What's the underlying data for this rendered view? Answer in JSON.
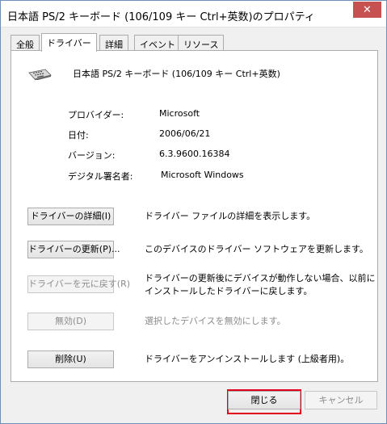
{
  "window": {
    "title": "日本語 PS/2 キーボード (106/109 キー Ctrl+英数)のプロパティ",
    "close_glyph": "✕"
  },
  "tabs": [
    {
      "label": "全般",
      "active": false
    },
    {
      "label": "ドライバー",
      "active": true
    },
    {
      "label": "詳細",
      "active": false
    },
    {
      "label": "イベント",
      "active": false
    },
    {
      "label": "リソース",
      "active": false
    }
  ],
  "device": {
    "name": "日本語 PS/2 キーボード (106/109 キー Ctrl+英数)",
    "icon": "keyboard-icon"
  },
  "info": [
    {
      "label": "プロバイダー:",
      "value": "Microsoft"
    },
    {
      "label": "日付:",
      "value": "2006/06/21"
    },
    {
      "label": "バージョン:",
      "value": "6.3.9600.16384"
    },
    {
      "label": "デジタル署名者:",
      "value": "Microsoft Windows"
    }
  ],
  "actions": [
    {
      "button": "ドライバーの詳細(I)",
      "desc": "ドライバー ファイルの詳細を表示します。",
      "enabled": true
    },
    {
      "button": "ドライバーの更新(P)...",
      "desc": "このデバイスのドライバー ソフトウェアを更新します。",
      "enabled": true
    },
    {
      "button": "ドライバーを元に戻す(R)",
      "desc": "ドライバーの更新後にデバイスが動作しない場合、以前に",
      "desc2": "インストールしたドライバーに戻します。",
      "enabled": false
    },
    {
      "button": "無効(D)",
      "desc": "選択したデバイスを無効にします。",
      "enabled": false
    },
    {
      "button": "削除(U)",
      "desc": "ドライバーをアンインストールします (上級者用)。",
      "enabled": true
    }
  ],
  "footer": {
    "close_label": "閉じる",
    "cancel_label": "キャンセル"
  }
}
